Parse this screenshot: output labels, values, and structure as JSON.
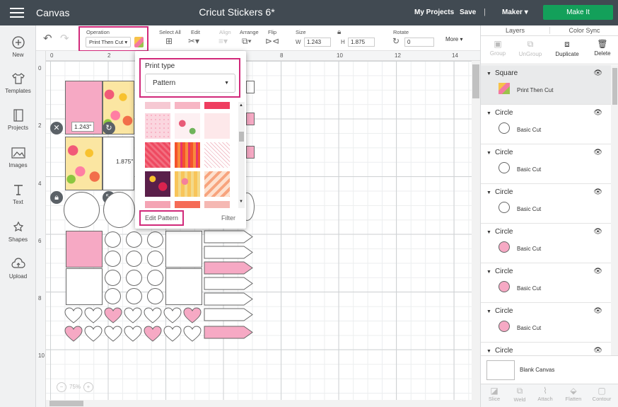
{
  "header": {
    "app_title": "Canvas",
    "project_title": "Cricut Stickers 6*",
    "my_projects": "My Projects",
    "save": "Save",
    "separator": "|",
    "machine": "Maker",
    "make_it": "Make It",
    "accent_color": "#13a05a",
    "bar_color": "#414a52"
  },
  "sidebar": {
    "items": [
      {
        "label": "New",
        "icon": "plus-circle-icon"
      },
      {
        "label": "Templates",
        "icon": "shirt-icon"
      },
      {
        "label": "Projects",
        "icon": "book-icon"
      },
      {
        "label": "Images",
        "icon": "image-icon"
      },
      {
        "label": "Text",
        "icon": "text-icon"
      },
      {
        "label": "Shapes",
        "icon": "shapes-icon"
      },
      {
        "label": "Upload",
        "icon": "cloud-upload-icon"
      }
    ]
  },
  "toolbar": {
    "operation_label": "Operation",
    "operation_value": "Print Then Cut",
    "select_all": "Select All",
    "edit": "Edit",
    "align": "Align",
    "arrange": "Arrange",
    "flip": "Flip",
    "size": "Size",
    "w_label": "W",
    "w_value": "1.243",
    "h_label": "H",
    "h_value": "1.875",
    "rotate": "Rotate",
    "rotate_value": "0",
    "more": "More"
  },
  "rulers": {
    "top": [
      "0",
      "2",
      "8",
      "10",
      "12",
      "14"
    ],
    "left": [
      "0",
      "2",
      "4",
      "6",
      "8",
      "10"
    ]
  },
  "canvas": {
    "width_dim": "1.243\"",
    "height_dim": "1.875\"",
    "zoom": "75%"
  },
  "popup": {
    "title": "Print type",
    "selected": "Pattern",
    "edit_pattern": "Edit Pattern",
    "filter": "Filter",
    "highlight_color": "#d1297a"
  },
  "layers_panel": {
    "tabs": [
      "Layers",
      "Color Sync"
    ],
    "actions": [
      "Group",
      "UnGroup",
      "Duplicate",
      "Delete"
    ],
    "layers": [
      {
        "name": "Square",
        "sub": "Print Then Cut",
        "thumb": "pattern",
        "selected": true
      },
      {
        "name": "Circle",
        "sub": "Basic Cut",
        "thumb": "#ffffff"
      },
      {
        "name": "Circle",
        "sub": "Basic Cut",
        "thumb": "#ffffff"
      },
      {
        "name": "Circle",
        "sub": "Basic Cut",
        "thumb": "#ffffff"
      },
      {
        "name": "Circle",
        "sub": "Basic Cut",
        "thumb": "#f6a9c4"
      },
      {
        "name": "Circle",
        "sub": "Basic Cut",
        "thumb": "#f6a9c4"
      },
      {
        "name": "Circle",
        "sub": "Basic Cut",
        "thumb": "#f6a9c4"
      },
      {
        "name": "Circle",
        "sub": "",
        "thumb": ""
      }
    ],
    "blank_canvas": "Blank Canvas",
    "bottom_actions": [
      "Slice",
      "Weld",
      "Attach",
      "Flatten",
      "Contour"
    ]
  }
}
